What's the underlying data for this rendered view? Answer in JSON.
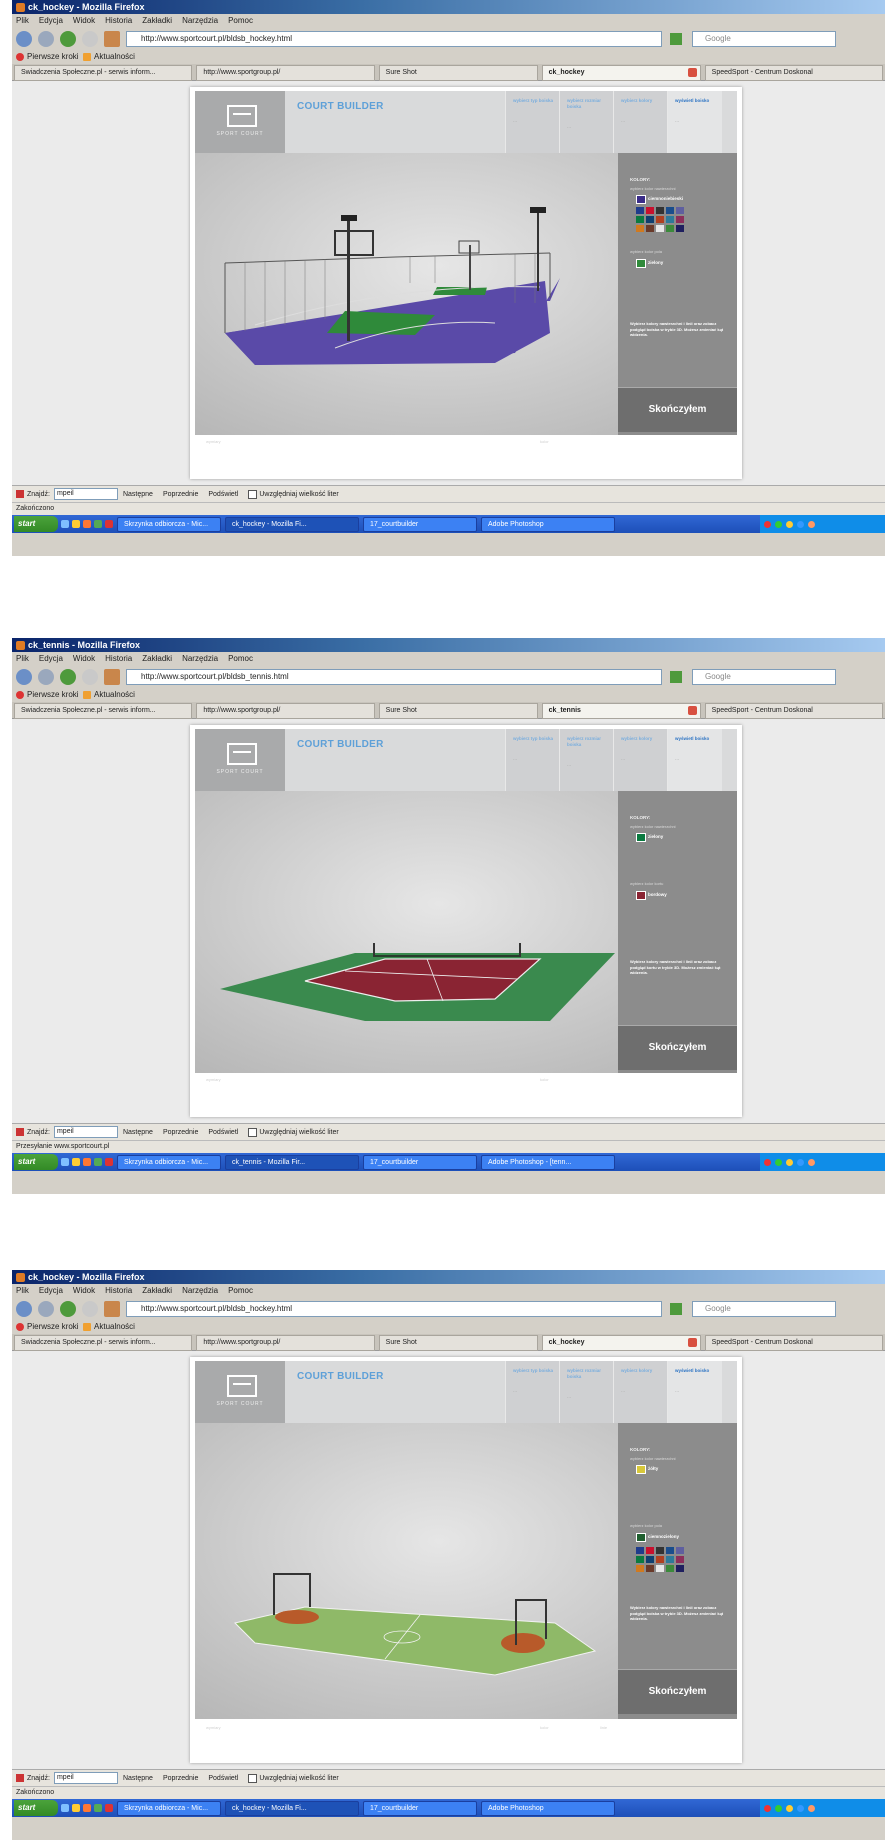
{
  "hockey": {
    "window_title": "ck_hockey - Mozilla Firefox",
    "url": "http://www.sportcourt.pl/bldsb_hockey.html",
    "tabs": [
      "Swiadczenia Społeczne.pl - serwis inform...",
      "http://www.sportgroup.pl/",
      "Sure Shot",
      "ck_hockey",
      "SpeedSport - Centrum Doskonal"
    ],
    "active_tab": 3,
    "status": "Zakończono",
    "taskbar_items": [
      "Skrzynka odbiorcza - Mic...",
      "ck_hockey - Mozilla Fi...",
      "17_courtbuilder",
      "Adobe Photoshop"
    ],
    "side": {
      "title": "KOLORY:",
      "sub": "wybierz kolor nawierzchni",
      "selected": "ciemnoniebieski",
      "second_sub": "wybierz kolor pola",
      "second_label": "zielony",
      "desc": "Wybierz kolory nawierzchni i linii oraz zobacz podgląd boiska w trybie 3D. Możesz zmieniać kąt widzenia."
    },
    "foot_left_k": "wymiary",
    "foot_left": "28 x 15 m  -  24 x 13 wewnątrz (Hockey, Koszykówka)",
    "foot_mid_k": "kolor",
    "foot_mid": "ciemnoniebieski",
    "foot_right_k": "",
    "foot_right": "zielony"
  },
  "tennis": {
    "window_title": "ck_tennis - Mozilla Firefox",
    "url": "http://www.sportcourt.pl/bldsb_tennis.html",
    "tabs": [
      "Swiadczenia Społeczne.pl - serwis inform...",
      "http://www.sportgroup.pl/",
      "Sure Shot",
      "ck_tennis",
      "SpeedSport - Centrum Doskonal"
    ],
    "active_tab": 3,
    "status": "Przesyłanie www.sportcourt.pl",
    "taskbar_items": [
      "Skrzynka odbiorcza - Mic...",
      "ck_tennis - Mozilla Fir...",
      "17_courtbuilder",
      "Adobe Photoshop - [tenn..."
    ],
    "side": {
      "title": "KOLORY:",
      "sub": "wybierz kolor nawierzchni",
      "selected": "zielony",
      "second_sub": "wybierz kolor kortu",
      "second_label": "bordowy",
      "desc": "Wybierz kolory nawierzchni i linii oraz zobacz podgląd kortu w trybie 3D. Możesz zmieniać kąt widzenia."
    },
    "foot_left_k": "wymiary",
    "foot_left": "36 x 18 m     tenis 1 kort",
    "foot_mid_k": "kolor",
    "foot_mid": "zielony",
    "foot_right_k": "",
    "foot_right": "bordowy"
  },
  "hockey2": {
    "window_title": "ck_hockey - Mozilla Firefox",
    "url": "http://www.sportcourt.pl/bldsb_hockey.html",
    "tabs": [
      "Swiadczenia Społeczne.pl - serwis inform...",
      "http://www.sportgroup.pl/",
      "Sure Shot",
      "ck_hockey",
      "SpeedSport - Centrum Doskonal"
    ],
    "active_tab": 3,
    "status": "Zakończono",
    "taskbar_items": [
      "Skrzynka odbiorcza - Mic...",
      "ck_hockey - Mozilla Fi...",
      "17_courtbuilder",
      "Adobe Photoshop"
    ],
    "side": {
      "title": "KOLORY:",
      "sub": "wybierz kolor nawierzchni",
      "selected": "żółty",
      "second_sub": "wybierz kolor pola",
      "second_label": "ciemnozielony",
      "desc": "Wybierz kolory nawierzchni i linii oraz zobacz podgląd boiska w trybie 3D. Możesz zmieniać kąt widzenia."
    },
    "foot_left_k": "wymiary",
    "foot_left": "28 x 15 m     koszykówka",
    "foot_mid_k": "kolor",
    "foot_mid": "żółty",
    "foot_right_k": "linie",
    "foot_right": "ciemnozielony"
  },
  "common": {
    "menu": [
      "Plik",
      "Edycja",
      "Widok",
      "Historia",
      "Zakładki",
      "Narzędzia",
      "Pomoc"
    ],
    "search_placeholder": "Google",
    "bookmarks": [
      "Pierwsze kroki",
      "Aktualności"
    ],
    "app_title": "COURT BUILDER",
    "logo_sub": "SPORT COURT",
    "steps": [
      {
        "t": "wybierz typ boiska",
        "v": "..."
      },
      {
        "t": "wybierz rozmiar boiska",
        "v": "..."
      },
      {
        "t": "wybierz kolory",
        "v": "..."
      },
      {
        "t": "wyświetl boisko",
        "v": "..."
      }
    ],
    "finish": "Skończyłem",
    "find_label": "Znajdź:",
    "find_value": "mpeil",
    "find_next": "Następne",
    "find_prev": "Poprzednie",
    "highlight": "Podświetl",
    "match_case": "Uwzględniaj wielkość liter",
    "start": "start"
  },
  "colors": {
    "purple_court": "#5a4aa8",
    "green_key": "#2f8a3a",
    "tennis_outer": "#3a8a4e",
    "tennis_inner": "#8a2433",
    "light_green": "#8fb968",
    "orange_key": "#b85a2a",
    "accent_blue": "#5ea0d8"
  }
}
